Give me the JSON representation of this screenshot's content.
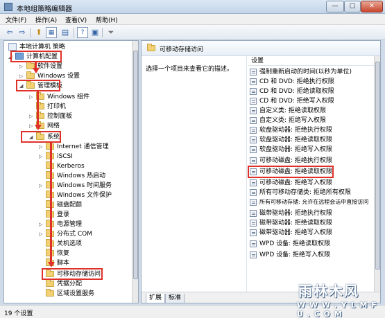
{
  "window": {
    "title": "本地组策略编辑器",
    "minimize": "—",
    "maximize": "□",
    "close": "✕"
  },
  "menu": [
    "文件(F)",
    "操作(A)",
    "查看(V)",
    "帮助(H)"
  ],
  "toolbar": {
    "back": "⇦",
    "forward": "⇨",
    "up": "⬆",
    "view1": "▦",
    "view2": "▤",
    "export": "▢",
    "help": "?",
    "props": "▣",
    "filter": "⏷"
  },
  "tree": {
    "items": [
      {
        "label": "本地计算机 策略",
        "icon": "policy-icon",
        "arrow": ""
      },
      {
        "label": "计算机配置",
        "icon": "computer-icon",
        "arrow": "◢"
      },
      {
        "label": "软件设置",
        "icon": "folder-icon",
        "arrow": "▷"
      },
      {
        "label": "Windows 设置",
        "icon": "folder-icon",
        "arrow": "▷"
      },
      {
        "label": "管理模板",
        "icon": "folder-icon",
        "arrow": "◢"
      },
      {
        "label": "Windows 组件",
        "icon": "folder-icon",
        "arrow": "▷"
      },
      {
        "label": "打印机",
        "icon": "folder-icon",
        "arrow": ""
      },
      {
        "label": "控制面板",
        "icon": "folder-icon",
        "arrow": "▷"
      },
      {
        "label": "网络",
        "icon": "folder-icon",
        "arrow": "▷"
      },
      {
        "label": "系统",
        "icon": "folder-icon",
        "arrow": "◢"
      },
      {
        "label": "Internet 通信管理",
        "icon": "folder-icon",
        "arrow": "▷"
      },
      {
        "label": "iSCSI",
        "icon": "folder-icon",
        "arrow": "▷"
      },
      {
        "label": "Kerberos",
        "icon": "folder-icon",
        "arrow": ""
      },
      {
        "label": "Windows 热启动",
        "icon": "folder-icon",
        "arrow": ""
      },
      {
        "label": "Windows 时间服务",
        "icon": "folder-icon",
        "arrow": "▷"
      },
      {
        "label": "Windows 文件保护",
        "icon": "folder-icon",
        "arrow": ""
      },
      {
        "label": "磁盘配额",
        "icon": "folder-icon",
        "arrow": ""
      },
      {
        "label": "登录",
        "icon": "folder-icon",
        "arrow": ""
      },
      {
        "label": "电源管理",
        "icon": "folder-icon",
        "arrow": "▷"
      },
      {
        "label": "分布式 COM",
        "icon": "folder-icon",
        "arrow": "▷"
      },
      {
        "label": "关机选项",
        "icon": "folder-icon",
        "arrow": ""
      },
      {
        "label": "恢复",
        "icon": "folder-icon",
        "arrow": ""
      },
      {
        "label": "脚本",
        "icon": "folder-icon",
        "arrow": ""
      },
      {
        "label": "可移动存储访问",
        "icon": "folder-icon",
        "arrow": ""
      },
      {
        "label": "凭据分配",
        "icon": "folder-icon",
        "arrow": ""
      },
      {
        "label": "区域设置服务",
        "icon": "folder-icon",
        "arrow": ""
      }
    ]
  },
  "right": {
    "header": "可移动存储访问",
    "description": "选择一个项目来查看它的描述。",
    "settings_header": "设置",
    "settings": [
      "强制重新启动的时间(以秒为单位)",
      "CD 和 DVD: 拒绝执行权限",
      "CD 和 DVD: 拒绝读取权限",
      "CD 和 DVD: 拒绝写入权限",
      "自定义类: 拒绝读取权限",
      "自定义类: 拒绝写入权限",
      "软盘驱动器: 拒绝执行权限",
      "软盘驱动器: 拒绝读取权限",
      "软盘驱动器: 拒绝写入权限",
      "可移动磁盘: 拒绝执行权限",
      "可移动磁盘: 拒绝读取权限",
      "可移动磁盘: 拒绝写入权限",
      "所有可移动存储类: 拒绝所有权限",
      "所有可移动存储: 允许在远程会话中直接访问",
      "磁带驱动器: 拒绝执行权限",
      "磁带驱动器: 拒绝读取权限",
      "磁带驱动器: 拒绝写入权限",
      "WPD 设备: 拒绝读取权限",
      "WPD 设备: 拒绝写入权限"
    ],
    "tabs": [
      "扩展",
      "标准"
    ]
  },
  "status": "19 个设置",
  "watermark": {
    "title": "雨林木风",
    "url": "W W W . Y L M F U . C O M"
  },
  "colors": {
    "highlight": "#e0302a",
    "accent": "#3f5f86"
  }
}
